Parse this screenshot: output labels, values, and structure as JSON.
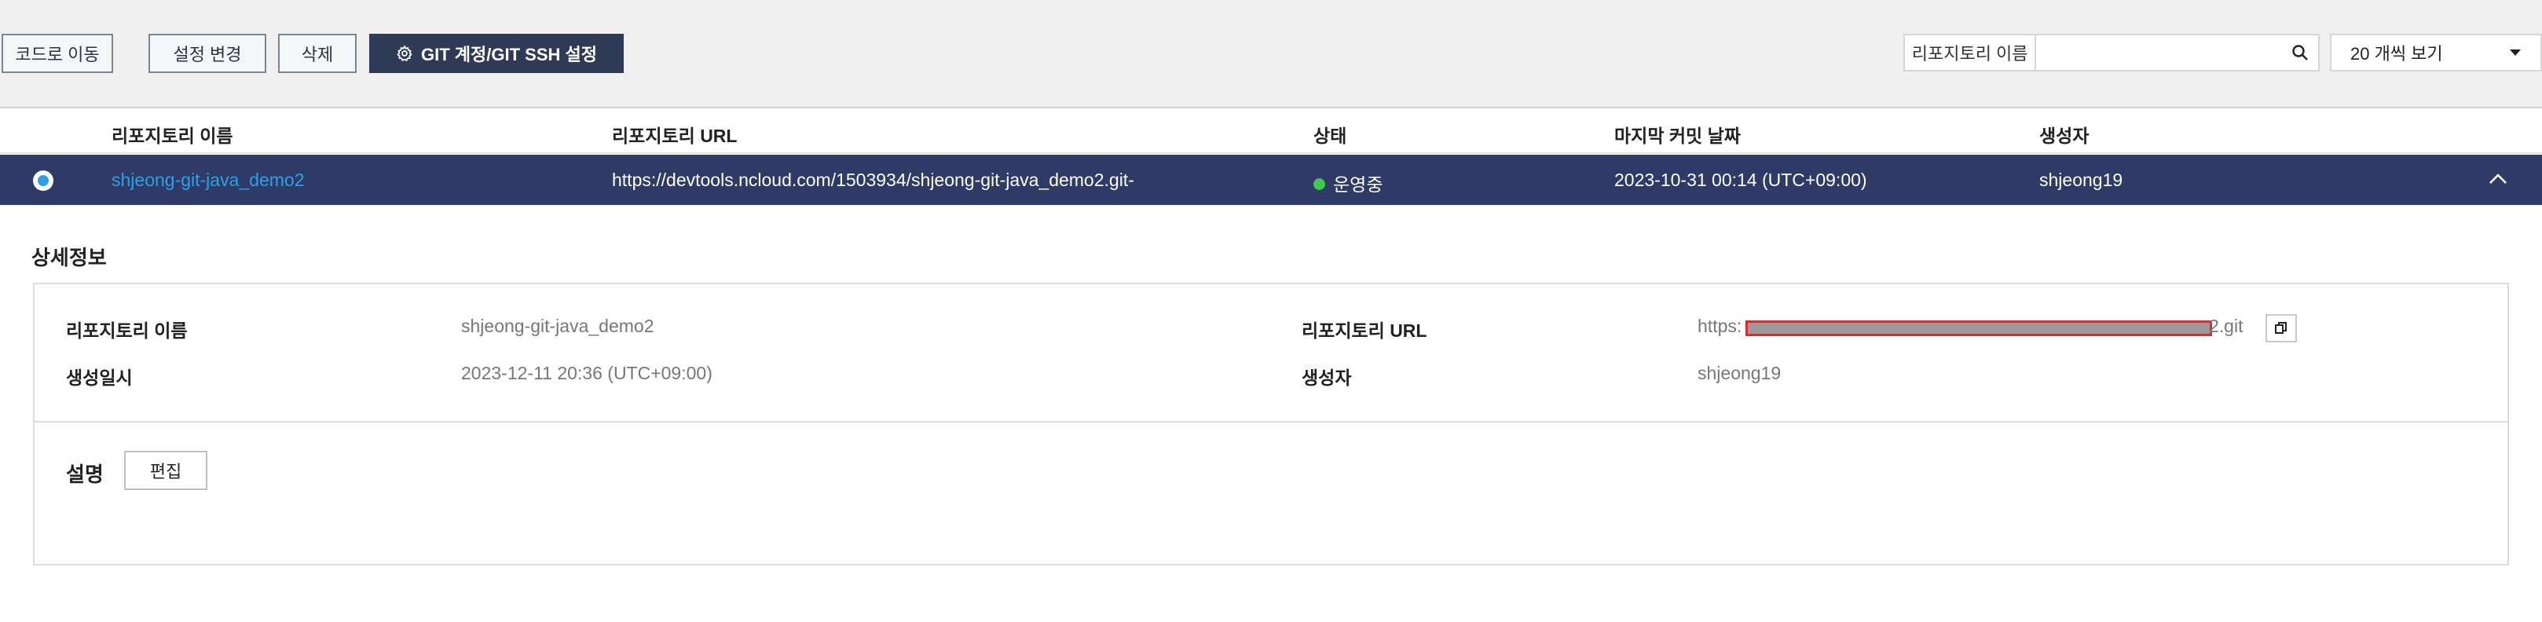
{
  "toolbar": {
    "buttons": [
      "코드로 이동",
      "설정 변경",
      "삭제"
    ],
    "primary_button": "GIT 계정/GIT SSH 설정",
    "search_label": "리포지토리 이름",
    "search_value": "",
    "search_icon": "search-icon",
    "page_size": "20 개씩 보기"
  },
  "table": {
    "headers": [
      "리포지토리 이름",
      "리포지토리 URL",
      "상태",
      "마지막 커밋 날짜",
      "생성자"
    ],
    "row": {
      "name": "shjeong-git-java_demo2",
      "url": "https://devtools.ncloud.com/1503934/shjeong-git-java_demo2.git-",
      "status": "운영중",
      "last_commit": "2023-10-31 00:14 (UTC+09:00)",
      "creator": "shjeong19"
    }
  },
  "detail": {
    "title": "상세정보",
    "repo_name_label": "리포지토리 이름",
    "repo_name_value": "shjeong-git-java_demo2",
    "created_label": "생성일시",
    "created_value": "2023-12-11 20:36 (UTC+09:00)",
    "repo_url_label": "리포지토리 URL",
    "repo_url_prefix": "https:",
    "repo_url_suffix": "2.git",
    "creator_label": "생성자",
    "creator_value": "shjeong19",
    "description_label": "설명",
    "edit_label": "편집"
  },
  "colors": {
    "selected_row": "#2f3b66",
    "primary_button": "#2f3b56",
    "link": "#2aa1e8",
    "status_green": "#3ec94b",
    "redaction_border": "#e0282e"
  }
}
